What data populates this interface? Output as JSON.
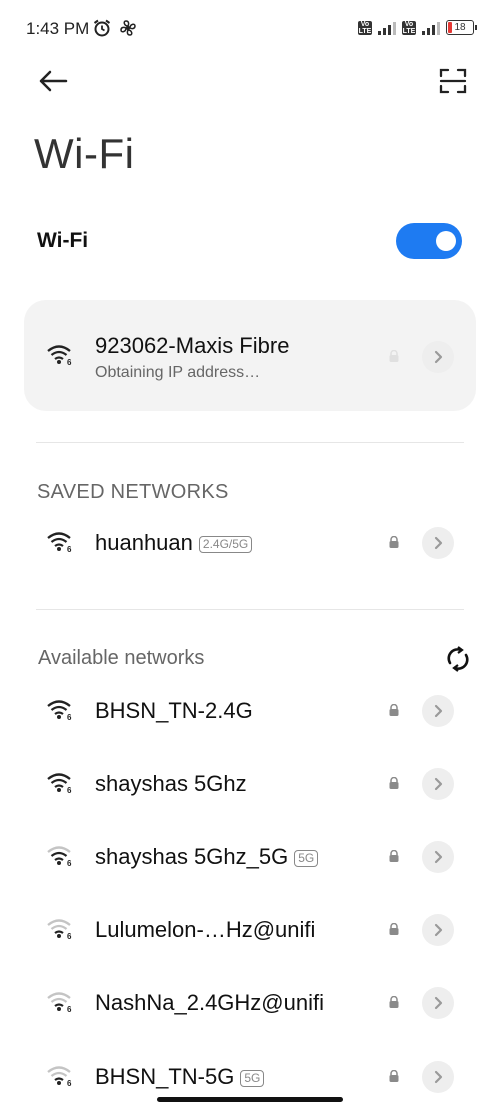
{
  "status_bar": {
    "time": "1:43 PM",
    "volte_label": "Vo LTE",
    "battery": "18"
  },
  "page": {
    "title": "Wi-Fi"
  },
  "wifi_toggle": {
    "label": "Wi-Fi",
    "enabled": true
  },
  "connecting": {
    "name": "923062-Maxis Fibre",
    "status": "Obtaining IP address…"
  },
  "saved_networks": {
    "header": "SAVED NETWORKS",
    "items": [
      {
        "name": "huanhuan",
        "badge": "2.4G/5G"
      }
    ]
  },
  "available_networks": {
    "header": "Available networks",
    "items": [
      {
        "name": "BHSN_TN-2.4G",
        "badge": ""
      },
      {
        "name": "shayshas 5Ghz",
        "badge": ""
      },
      {
        "name": "shayshas 5Ghz_5G",
        "badge": "5G"
      },
      {
        "name": "Lulumelon-…Hz@unifi",
        "badge": ""
      },
      {
        "name": "NashNa_2.4GHz@unifi",
        "badge": ""
      },
      {
        "name": "BHSN_TN-5G",
        "badge": "5G"
      }
    ]
  },
  "colors": {
    "accent": "#1e7bf2",
    "card": "#f3f3f3",
    "battery_low": "#e53935"
  }
}
